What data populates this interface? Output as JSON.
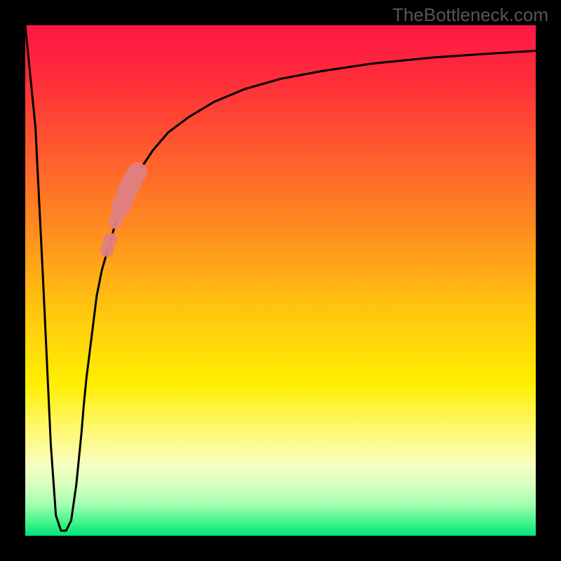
{
  "watermark": "TheBottleneck.com",
  "chart_data": {
    "type": "line",
    "title": "",
    "xlabel": "",
    "ylabel": "",
    "xlim": [
      0,
      100
    ],
    "ylim": [
      0,
      100
    ],
    "background": {
      "type": "vertical_gradient",
      "stops": [
        {
          "offset": 0.0,
          "color": "#ff1744"
        },
        {
          "offset": 0.1,
          "color": "#ff2b3a"
        },
        {
          "offset": 0.25,
          "color": "#ff5c2e"
        },
        {
          "offset": 0.4,
          "color": "#ff8c1f"
        },
        {
          "offset": 0.55,
          "color": "#ffc310"
        },
        {
          "offset": 0.7,
          "color": "#ffee00"
        },
        {
          "offset": 0.8,
          "color": "#fff97a"
        },
        {
          "offset": 0.86,
          "color": "#f7ffc0"
        },
        {
          "offset": 0.9,
          "color": "#d8ffbf"
        },
        {
          "offset": 0.94,
          "color": "#a0ffb0"
        },
        {
          "offset": 0.97,
          "color": "#4cf58e"
        },
        {
          "offset": 1.0,
          "color": "#00e57a"
        }
      ]
    },
    "series": [
      {
        "name": "bottleneck-curve",
        "color": "#000000",
        "stroke_width": 3,
        "x": [
          0,
          2,
          3.5,
          5,
          6,
          7,
          8,
          9,
          10,
          11,
          11.5,
          12,
          13,
          14,
          15,
          17,
          19,
          22,
          25,
          28,
          32,
          37,
          43,
          50,
          58,
          68,
          80,
          92,
          100
        ],
        "y": [
          100,
          80,
          50,
          18,
          4,
          1,
          1,
          3,
          10,
          20,
          26,
          31,
          39,
          47,
          52,
          59,
          65,
          71,
          75.5,
          79,
          82,
          85,
          87.5,
          89.5,
          91,
          92.5,
          93.7,
          94.5,
          95
        ]
      }
    ],
    "scatter": {
      "name": "highlighted-points",
      "color": "#e08080",
      "points": [
        {
          "x": 18.8,
          "y": 64.5,
          "r": 14
        },
        {
          "x": 19.2,
          "y": 65.5,
          "r": 14
        },
        {
          "x": 19.7,
          "y": 66.8,
          "r": 14
        },
        {
          "x": 20.2,
          "y": 68.0,
          "r": 14
        },
        {
          "x": 20.8,
          "y": 69.2,
          "r": 14
        },
        {
          "x": 21.4,
          "y": 70.3,
          "r": 14
        },
        {
          "x": 22.0,
          "y": 71.2,
          "r": 14
        },
        {
          "x": 18.2,
          "y": 63.0,
          "r": 10
        },
        {
          "x": 17.6,
          "y": 61.5,
          "r": 10
        },
        {
          "x": 16.6,
          "y": 58.0,
          "r": 10
        },
        {
          "x": 16.0,
          "y": 56.0,
          "r": 10
        }
      ]
    },
    "frame": {
      "inner_margin": 36,
      "border_color": "#000000"
    },
    "grid": false,
    "legend": false
  }
}
